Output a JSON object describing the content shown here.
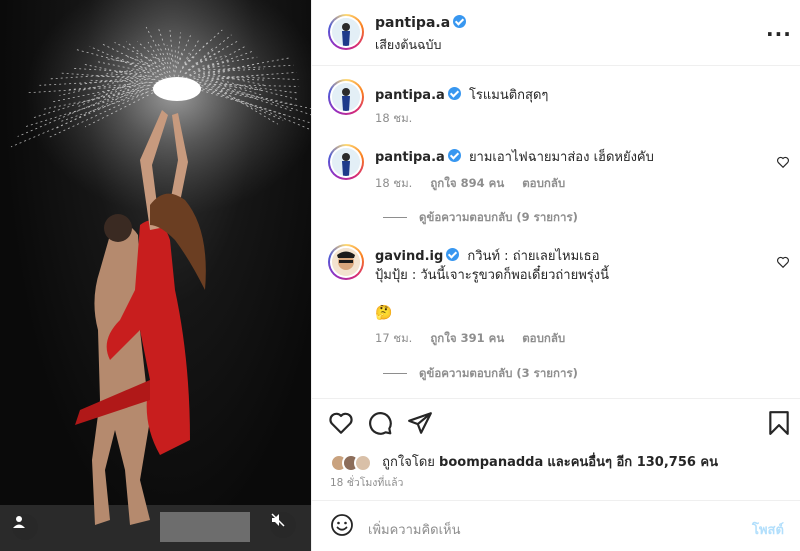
{
  "post": {
    "author": "pantipa.a",
    "audio": "เสียงต้นฉบับ",
    "caption": {
      "username": "pantipa.a",
      "text": "โรแมนติกสุดๆ",
      "time": "18 ชม."
    }
  },
  "comments": [
    {
      "username": "pantipa.a",
      "text": "ยามเอาไฟฉายมาส่อง เฮ็ดหยังคับ",
      "time": "18 ชม.",
      "likes": "ถูกใจ 894 คน",
      "reply": "ตอบกลับ",
      "view_replies": "ดูข้อความตอบกลับ (9 รายการ)"
    },
    {
      "username": "gavind.ig",
      "text_line1": "กวินท์ : ถ่ายเลยไหมเธอ",
      "text_line2": "ปุ้มปุ้ย : วันนี้เจาะรูขวดก็พอเดี๋ยวถ่ายพรุ่งนี้",
      "emoji": "🤔",
      "time": "17 ชม.",
      "likes": "ถูกใจ 391 คน",
      "reply": "ตอบกลับ",
      "view_replies": "ดูข้อความตอบกลับ (3 รายการ)"
    }
  ],
  "likes": {
    "prefix": "ถูกใจโดย",
    "user": "boompanadda",
    "suffix": "และคนอื่นๆ อีก 130,756 คน"
  },
  "timestamp": "18 ชั่วโมงที่แล้ว",
  "comment_box": {
    "placeholder": "เพิ่มความคิดเห็น",
    "post": "โพสต์"
  },
  "icons": {
    "more": "more-icon",
    "like": "heart-icon",
    "comment": "comment-icon",
    "share": "share-icon",
    "save": "bookmark-icon",
    "emoji": "emoji-icon",
    "tags": "user-tag-icon",
    "mute": "mute-icon"
  },
  "colors": {
    "verified": "#3897f0",
    "post_button": "#b2dffc",
    "secondary_text": "#8e8e8e"
  }
}
